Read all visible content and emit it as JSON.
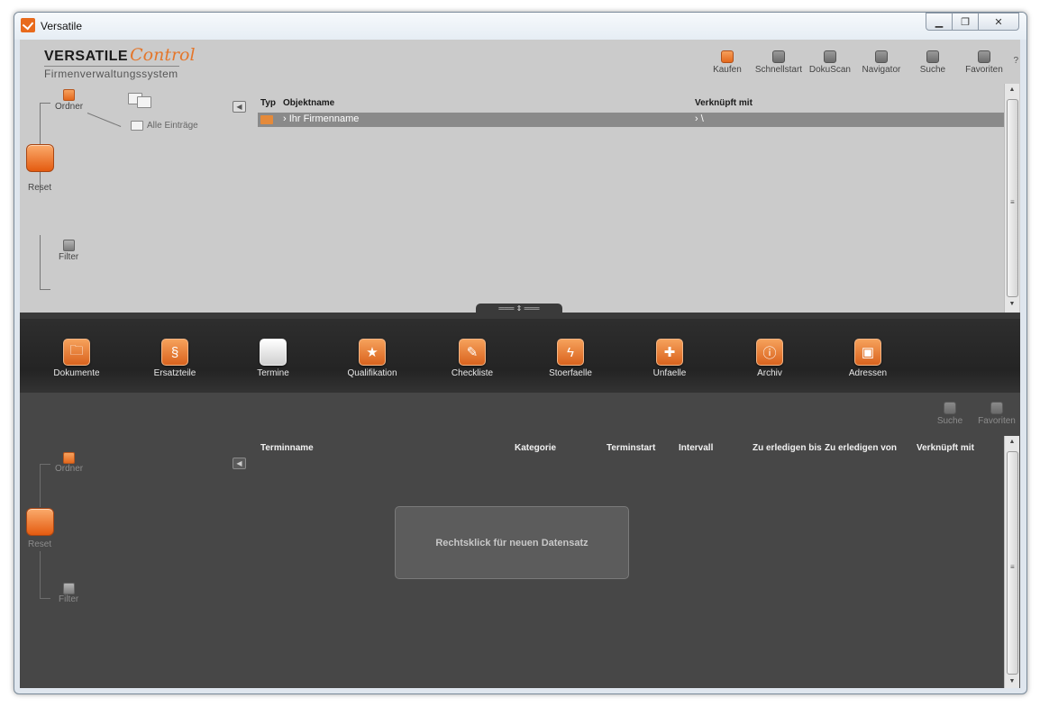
{
  "window": {
    "title": "Versatile",
    "buttons": [
      "minimize",
      "restore",
      "close"
    ]
  },
  "logo": {
    "main": "VERSATILE",
    "accent": "Control",
    "subtitle": "Firmenverwaltungssystem"
  },
  "toolbar": {
    "items": [
      {
        "label": "Kaufen",
        "active": true
      },
      {
        "label": "Schnellstart",
        "active": false
      },
      {
        "label": "DokuScan",
        "active": false
      },
      {
        "label": "Navigator",
        "active": false
      },
      {
        "label": "Suche",
        "active": false
      },
      {
        "label": "Favoriten",
        "active": false
      }
    ],
    "help": "?"
  },
  "top_tree": {
    "ordner": "Ordner",
    "alle_eintraege": "Alle Einträge",
    "reset": "Reset",
    "filter": "Filter"
  },
  "top_grid": {
    "headers": {
      "typ": "Typ",
      "objektname": "Objektname",
      "verknuepft": "Verknüpft mit"
    },
    "rows": [
      {
        "objektname": "› Ihr Firmenname",
        "verknuepft": "› \\"
      }
    ]
  },
  "modules": [
    {
      "label": "Dokumente",
      "icon": "folder-icon"
    },
    {
      "label": "Ersatzteile",
      "icon": "spare-parts-icon"
    },
    {
      "label": "Termine",
      "icon": "calendar-icon"
    },
    {
      "label": "Qualifikation",
      "icon": "star-icon"
    },
    {
      "label": "Checkliste",
      "icon": "checklist-icon"
    },
    {
      "label": "Stoerfaelle",
      "icon": "lightning-icon"
    },
    {
      "label": "Unfaelle",
      "icon": "first-aid-icon"
    },
    {
      "label": "Archiv",
      "icon": "info-icon"
    },
    {
      "label": "Adressen",
      "icon": "address-icon"
    }
  ],
  "bottom_toolbar": {
    "suche": "Suche",
    "favoriten": "Favoriten"
  },
  "bottom_tree": {
    "ordner": "Ordner",
    "reset": "Reset",
    "filter": "Filter"
  },
  "bottom_grid": {
    "headers": {
      "terminname": "Terminname",
      "kategorie": "Kategorie",
      "terminstart": "Terminstart",
      "intervall": "Intervall",
      "zu_erledigen_bis": "Zu erledigen bis",
      "zu_erledigen_von": "Zu erledigen von",
      "verknuepft": "Verknüpft mit"
    },
    "empty_hint": "Rechtsklick für neuen Datensatz"
  },
  "colors": {
    "accent": "#e4681c",
    "top_bg": "#cbcbcb",
    "bottom_bg": "#474747",
    "module_bar": "#2a2a2a"
  }
}
